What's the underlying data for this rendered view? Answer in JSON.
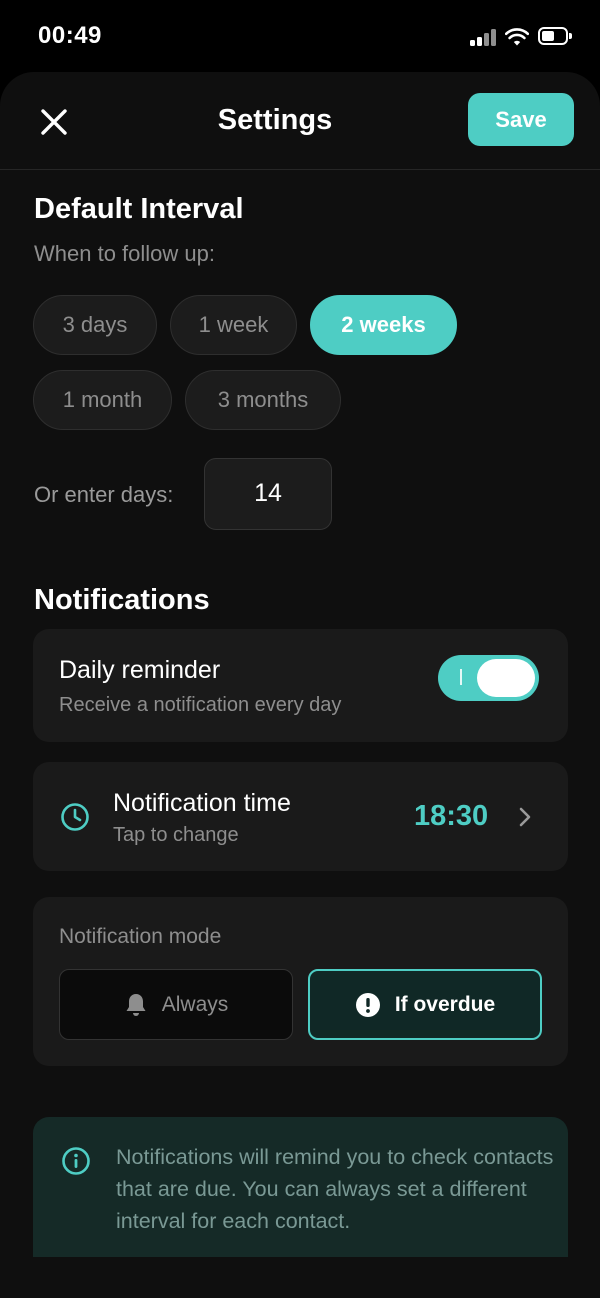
{
  "status_bar": {
    "time": "00:49",
    "battery_icon": "battery-icon",
    "wifi_icon": "wifi-icon",
    "signal_icon": "signal-icon"
  },
  "header": {
    "title": "Settings",
    "save_label": "Save",
    "close_icon": "close-icon"
  },
  "default_interval": {
    "title": "Default Interval",
    "subtitle": "When to follow up:",
    "options": [
      {
        "label": "3 days",
        "selected": false
      },
      {
        "label": "1 week",
        "selected": false
      },
      {
        "label": "2 weeks",
        "selected": true
      },
      {
        "label": "1 month",
        "selected": false
      },
      {
        "label": "3 months",
        "selected": false
      }
    ],
    "custom_label": "Or enter days:",
    "custom_value": "14"
  },
  "notifications": {
    "title": "Notifications",
    "daily_reminder": {
      "title": "Daily reminder",
      "subtitle": "Receive a notification every day",
      "enabled": true
    },
    "notification_time": {
      "title": "Notification time",
      "subtitle": "Tap to change",
      "value": "18:30",
      "icon": "clock-icon"
    },
    "mode": {
      "label": "Notification mode",
      "options": [
        {
          "label": "Always",
          "icon": "bell-icon",
          "selected": false
        },
        {
          "label": "If overdue",
          "icon": "exclamation-circle-icon",
          "selected": true
        }
      ]
    },
    "info": "Notifications will remind you to check contacts that are due. You can always set a different interval for each contact."
  },
  "colors": {
    "accent": "#4ecdc4",
    "background": "#000000",
    "card": "#1a1a1a",
    "muted_text": "#8e8e8e"
  }
}
